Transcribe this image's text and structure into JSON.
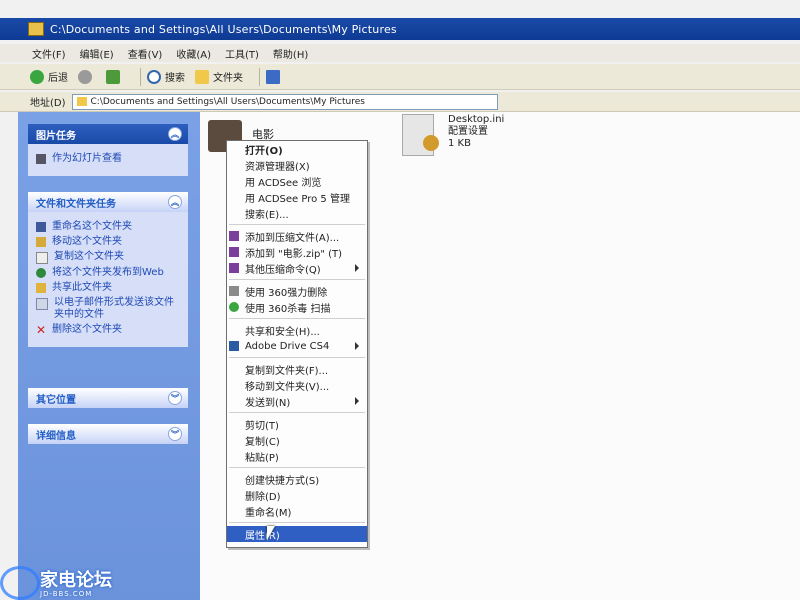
{
  "window": {
    "title": "C:\\Documents and Settings\\All Users\\Documents\\My Pictures"
  },
  "menubar": [
    "文件(F)",
    "编辑(E)",
    "查看(V)",
    "收藏(A)",
    "工具(T)",
    "帮助(H)"
  ],
  "toolbar": {
    "back": "后退",
    "search": "搜索",
    "folders": "文件夹"
  },
  "address": {
    "label": "地址(D)",
    "value": "C:\\Documents and Settings\\All Users\\Documents\\My Pictures"
  },
  "sidebar": {
    "picture_tasks": {
      "title": "图片任务",
      "items": [
        "作为幻灯片查看"
      ]
    },
    "file_tasks": {
      "title": "文件和文件夹任务",
      "items": [
        "重命名这个文件夹",
        "移动这个文件夹",
        "复制这个文件夹",
        "将这个文件夹发布到Web",
        "共享此文件夹",
        "以电子邮件形式发送该文件夹中的文件",
        "删除这个文件夹"
      ]
    },
    "other_places": {
      "title": "其它位置"
    },
    "details": {
      "title": "详细信息"
    }
  },
  "files": [
    {
      "name": "电影",
      "type": "",
      "size": ""
    },
    {
      "name": "Desktop.ini",
      "type": "配置设置",
      "size": "1 KB"
    }
  ],
  "context_menu": {
    "items": [
      "打开(O)",
      "资源管理器(X)",
      "用 ACDSee 浏览",
      "用 ACDSee Pro 5 管理",
      "搜索(E)...",
      "添加到压缩文件(A)...",
      "添加到 \"电影.zip\" (T)",
      "其他压缩命令(Q)",
      "使用 360强力删除",
      "使用 360杀毒 扫描",
      "共享和安全(H)...",
      "Adobe Drive CS4",
      "复制到文件夹(F)...",
      "移动到文件夹(V)...",
      "发送到(N)",
      "剪切(T)",
      "复制(C)",
      "粘贴(P)",
      "创建快捷方式(S)",
      "删除(D)",
      "重命名(M)",
      "属性(R)"
    ]
  },
  "watermark": {
    "text": "家电论坛",
    "sub": "JD-BBS.COM"
  },
  "colors": {
    "titlebar": "#1a4aa8",
    "sidebar": "#6b93dc",
    "menu_highlight": "#2f5fc3"
  }
}
